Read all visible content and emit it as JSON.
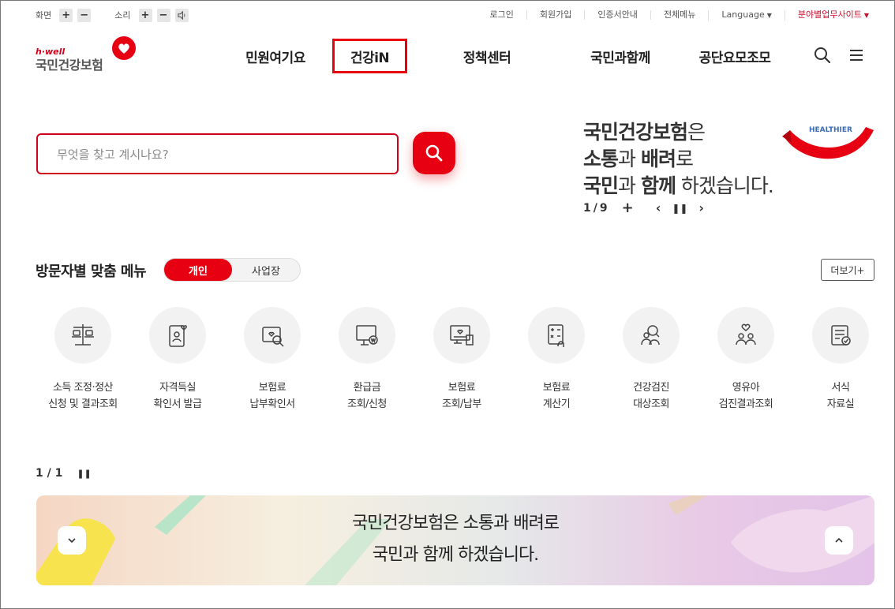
{
  "util": {
    "screen_label": "화면",
    "sound_label": "소리",
    "plus": "+",
    "minus": "−",
    "links": [
      "로그인",
      "회원가입",
      "인증서안내",
      "전체메뉴"
    ],
    "language": "Language",
    "field_site": "분야별업무사이트"
  },
  "logo": {
    "hwell": "h·well",
    "name": "국민건강보험"
  },
  "gnb": [
    {
      "label": "민원여기요",
      "active": false
    },
    {
      "label": "건강iN",
      "active": true
    },
    {
      "label": "정책센터",
      "active": false
    },
    {
      "label": "국민과함께",
      "active": false
    },
    {
      "label": "공단요모조모",
      "active": false
    }
  ],
  "search": {
    "placeholder": "무엇을 찾고 계시나요?"
  },
  "slogan": {
    "line1_bold": "국민건강보험",
    "line1_rest": "은",
    "line2_bold1": "소통",
    "line2_mid": "과 ",
    "line2_bold2": "배려",
    "line2_rest": "로",
    "line3_bold1": "국민",
    "line3_mid": "과 ",
    "line3_bold2": "함께",
    "line3_rest": " 하겠습니다.",
    "badge": "HEALTHIER"
  },
  "hero_pager": {
    "current": "1",
    "total": "9"
  },
  "visitor_menu": {
    "title": "방문자별 맞춤 메뉴",
    "tab_personal": "개인",
    "tab_business": "사업장",
    "more": "더보기+",
    "items": [
      {
        "l1": "소득 조정·정산",
        "l2": "신청 및 결과조회",
        "icon": "scale-icon"
      },
      {
        "l1": "자격득실",
        "l2": "확인서 발급",
        "icon": "id-card-heart-icon"
      },
      {
        "l1": "보험료",
        "l2": "납부확인서",
        "icon": "heart-search-icon"
      },
      {
        "l1": "환급금",
        "l2": "조회/신청",
        "icon": "monitor-won-icon"
      },
      {
        "l1": "보험료",
        "l2": "조회/납부",
        "icon": "monitor-doc-icon"
      },
      {
        "l1": "보험료",
        "l2": "계산기",
        "icon": "calculator-icon"
      },
      {
        "l1": "건강검진",
        "l2": "대상조회",
        "icon": "people-search-icon"
      },
      {
        "l1": "영유아",
        "l2": "검진결과조회",
        "icon": "family-heart-icon"
      },
      {
        "l1": "서식",
        "l2": "자료실",
        "icon": "form-doc-icon"
      }
    ]
  },
  "menu_pager": {
    "text": "1 / 1"
  },
  "banner": {
    "line1": "국민건강보험은 소통과 배려로",
    "line2": "국민과 함께 하겠습니다."
  }
}
